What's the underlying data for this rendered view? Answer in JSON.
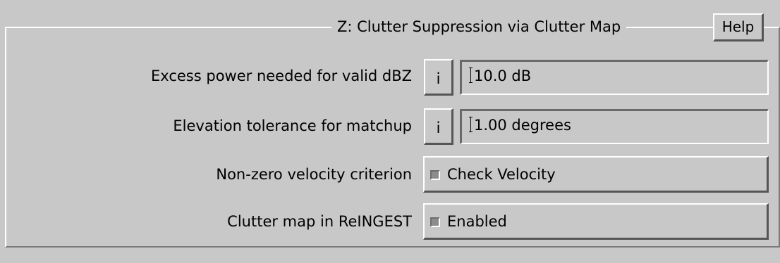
{
  "panel": {
    "title": "Z: Clutter Suppression via Clutter Map",
    "help_label": "Help"
  },
  "rows": [
    {
      "label": "Excess power needed for valid dBZ",
      "info_label": "i",
      "value": "10.0 dB"
    },
    {
      "label": "Elevation tolerance for matchup",
      "info_label": "i",
      "value": "1.00 degrees"
    },
    {
      "label": "Non-zero velocity criterion",
      "checkbox_label": "Check Velocity",
      "checked": false
    },
    {
      "label": "Clutter map in ReINGEST",
      "checkbox_label": "Enabled",
      "checked": false
    }
  ]
}
